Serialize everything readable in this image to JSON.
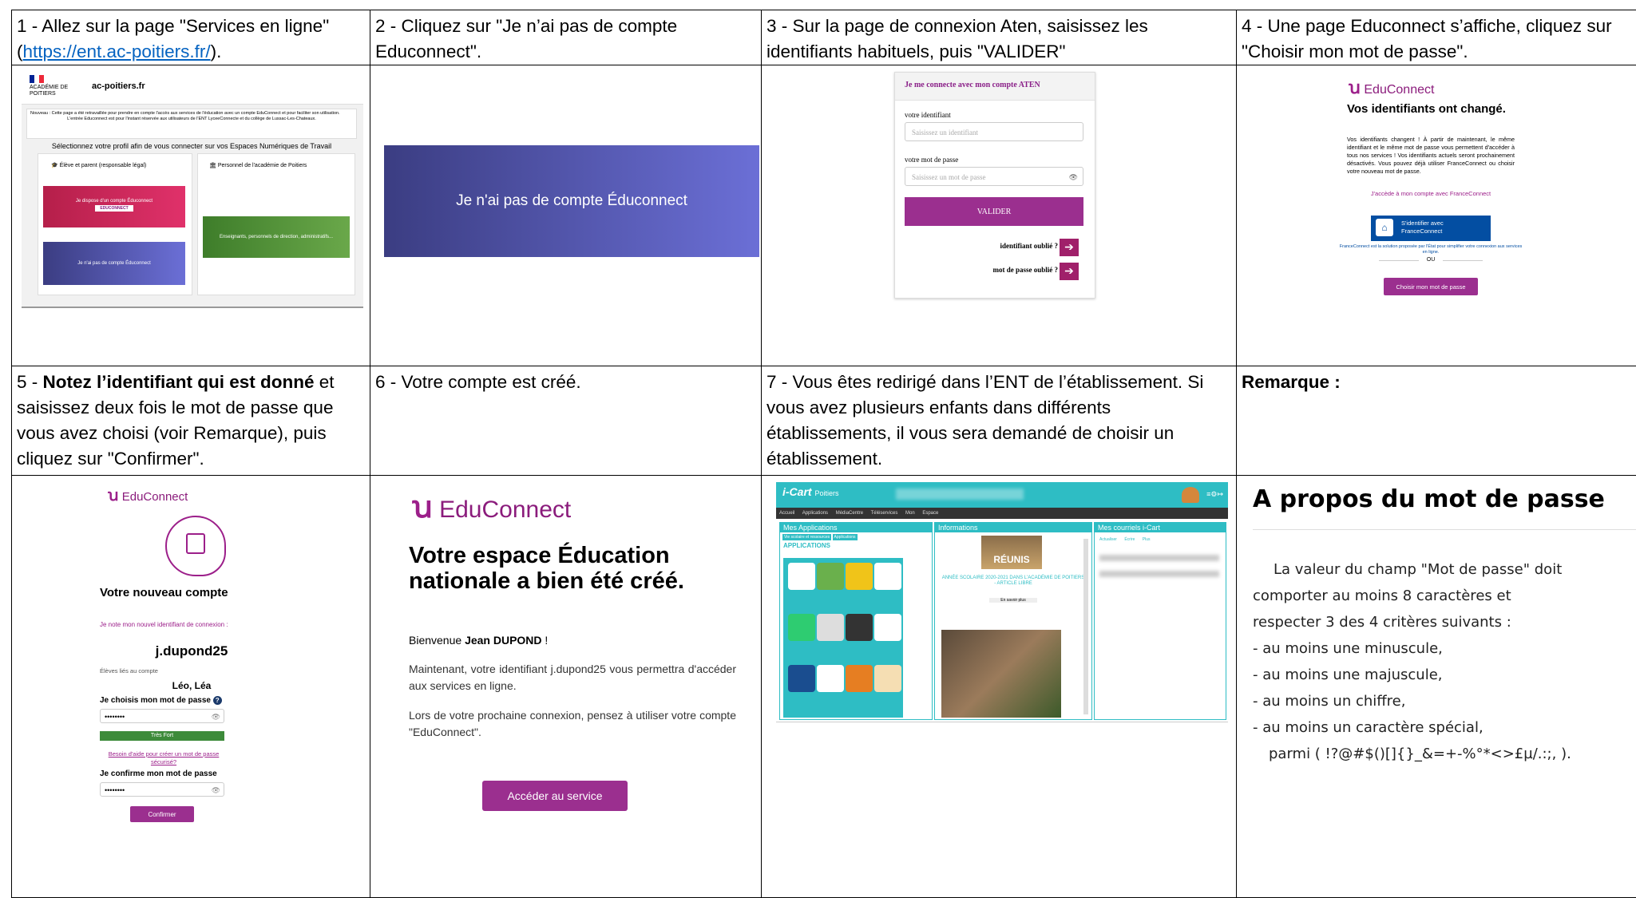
{
  "captions": {
    "c1_text": "1 - Allez sur la page \"Services en ligne\" (",
    "c1_link": "https://ent.ac-poitiers.fr/",
    "c1_end": ").",
    "c2": "2 - Cliquez sur \"Je n’ai pas de compte Educonnect\".",
    "c3": "3 - Sur la page de connexion Aten, saisissez les identifiants habituels, puis \"VALIDER\"",
    "c4": "4 - Une page Educonnect s’affiche, cliquez sur \"Choisir mon mot de passe\".",
    "c5_pre": "5 - ",
    "c5_bold": "Notez l’identifiant qui est donné",
    "c5_post": " et saisissez deux fois le mot de passe que vous avez choisi (voir Remarque), puis cliquez sur \"Confirmer\".",
    "c6": "6 - Votre compte est créé.",
    "c7": "7 - Vous êtes redirigé dans l’ENT de l’établissement. Si vous avez plusieurs enfants dans différents établissements, il vous sera demandé de choisir un établissement.",
    "c8": "Remarque :"
  },
  "shot1": {
    "republic": "ACADÉMIE DE POITIERS",
    "site": "ac-poitiers.fr",
    "notice": "Nouveau : Cette page a été retravaillée pour prendre en compte l'accès aux services de l'éducation avec un compte EduConnect et pour faciliter son utilisation.",
    "notice2": "L'entrée Educonnect est pour l'instant réservée aux utilisateurs de l'ENT LyceeConnecte et du collège de Lussac-Les-Chateaux.",
    "select_profile": "Sélectionnez votre profil afin de vous connecter sur vos Espaces Numériques de Travail",
    "col_left": "Élève et parent (responsable légal)",
    "col_right": "Personnel de l'académie de Poitiers",
    "btn_has_account": "Je dispose d'un compte Éduconnect",
    "btn_educonnect": "EDUCONNECT",
    "btn_no_account": "Je n'ai pas de compte Éduconnect",
    "btn_staff": "Enseignants, personnels de direction, administratifs..."
  },
  "shot2": {
    "button": "Je n'ai pas de compte Éduconnect"
  },
  "shot3": {
    "title": "Je me connecte avec mon compte ATEN",
    "id_label": "votre identifiant",
    "id_placeholder": "Saisissez un identifiant",
    "pw_label": "votre mot de passe",
    "pw_placeholder": "Saisissez un mot de passe",
    "validate": "VALIDER",
    "forgot_id": "identifiant oublié ?",
    "forgot_pw": "mot de passe oublié ?"
  },
  "shot4": {
    "brand": "EduConnect",
    "heading": "Vos identifiants ont changé.",
    "body": "Vos identifiants changent ! À partir de maintenant, le même identifiant et le même mot de passe vous permettent d'accéder à tous nos services ! Vos identifiants actuels seront prochainement désactivés. Vous pouvez déjà utiliser FranceConnect ou choisir votre nouveau mot de passe.",
    "fc_link": "J'accède à mon compte avec FranceConnect",
    "fc_btn1": "S'identifier avec",
    "fc_btn2": "FranceConnect",
    "fc_note": "FranceConnect est la solution proposée par l'État pour simplifier votre connexion aux services en ligne.",
    "or": "OU",
    "choose_pw": "Choisir mon mot de passe"
  },
  "shot5": {
    "brand": "EduConnect",
    "heading": "Votre nouveau compte",
    "note_label": "Je note mon nouvel identifiant de connexion :",
    "username": "j.dupond25",
    "students_label": "Élèves liés au compte",
    "students": "Léo, Léa",
    "choose_label": "Je choisis mon mot de passe",
    "pw_mask": "••••••••",
    "strength": "Très Fort",
    "help": "Besoin d'aide pour créer un mot de passe sécurisé?",
    "confirm_label": "Je confirme mon mot de passe",
    "confirm_mask": "••••••••",
    "confirm_btn": "Confirmer"
  },
  "shot6": {
    "brand": "EduConnect",
    "heading": "Votre espace Éducation nationale a bien été créé.",
    "welcome_pre": "Bienvenue ",
    "welcome_name": "Jean DUPOND",
    "welcome_post": " !",
    "p1": "Maintenant, votre identifiant j.dupond25 vous permettra d'accéder aux services en ligne.",
    "p2": "Lors de votre prochaine connexion, pensez à utiliser votre compte \"EduConnect\".",
    "btn": "Accéder au service"
  },
  "shot7": {
    "brand": "i-Cart",
    "brand_sub": "Poitiers",
    "menu": [
      "Accueil",
      "Applications",
      "MédiaCentre",
      "Téléservices",
      "Mon Espace"
    ],
    "panel_apps": "Mes Applications",
    "panel_info": "Informations",
    "panel_mail": "Mes courriels i-Cart",
    "apps_tab1": "Vie scolaire et ressources",
    "apps_tab2": "Applications",
    "apps_heading": "APPLICATIONS",
    "info_reunis": "RÉUNIS",
    "info_title": "ANNÉE SCOLAIRE 2020-2021 DANS L'ACADÉMIE DE POITIERS - ARTICLE LIBRE",
    "info_more": "En savoir plus",
    "mail_actions": [
      "Actualiser",
      "Écrire",
      "Plus"
    ]
  },
  "remark": {
    "title": "A propos du mot de passe",
    "intro1": "La valeur du champ \"Mot de passe\" doit",
    "intro2": "comporter au moins 8 caractères et",
    "intro3": "respecter 3 des 4 critères suivants :",
    "items": [
      "- au moins une minuscule,",
      "- au moins une majuscule,",
      "- au moins un chiffre,",
      "- au moins un caractère spécial,"
    ],
    "special": "parmi ( !?@#$()[]{}_&=+-%°*<>£µ/.:;, )."
  },
  "colors": {
    "educonnect_purple": "#9c1f8a",
    "aten_purple": "#9b2f8f",
    "icart_teal": "#2ebdc4"
  }
}
